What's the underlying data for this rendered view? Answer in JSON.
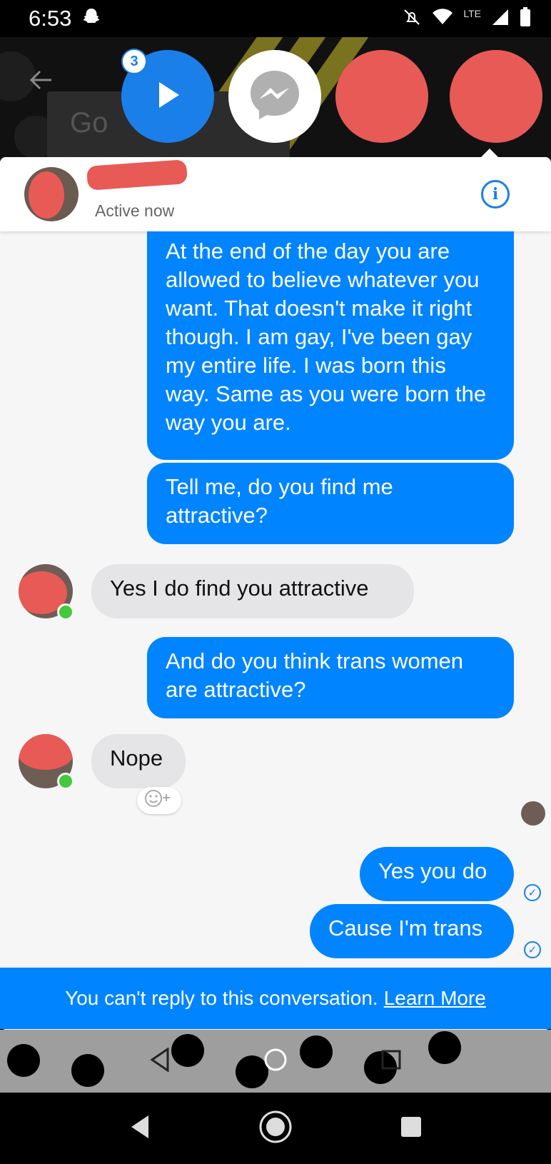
{
  "status_bar": {
    "time": "6:53",
    "network": "LTE"
  },
  "chat_heads": {
    "badge_count": "3"
  },
  "background": {
    "google_text": "Go"
  },
  "conversation": {
    "status": "Active now",
    "messages": [
      {
        "from": "me",
        "text": "At the end of the day you are allowed to believe whatever you want. That doesn't make it right though. I am gay, I've been gay my entire life. I was born this way. Same as you were born the way you are."
      },
      {
        "from": "me",
        "text": "Tell me, do you find me attractive?"
      },
      {
        "from": "them",
        "text": "Yes I do find you attractive"
      },
      {
        "from": "me",
        "text": "And do you think trans women are attractive?"
      },
      {
        "from": "them",
        "text": "Nope"
      },
      {
        "from": "me",
        "text": "Yes you do"
      },
      {
        "from": "me",
        "text": "Cause I'm trans"
      }
    ]
  },
  "banner": {
    "text": "You can't reply to this conversation.",
    "link": "Learn More"
  },
  "colors": {
    "accent": "#0084ff",
    "incoming": "#e5e5e8",
    "redaction": "#e85a56",
    "online": "#43c93b"
  }
}
